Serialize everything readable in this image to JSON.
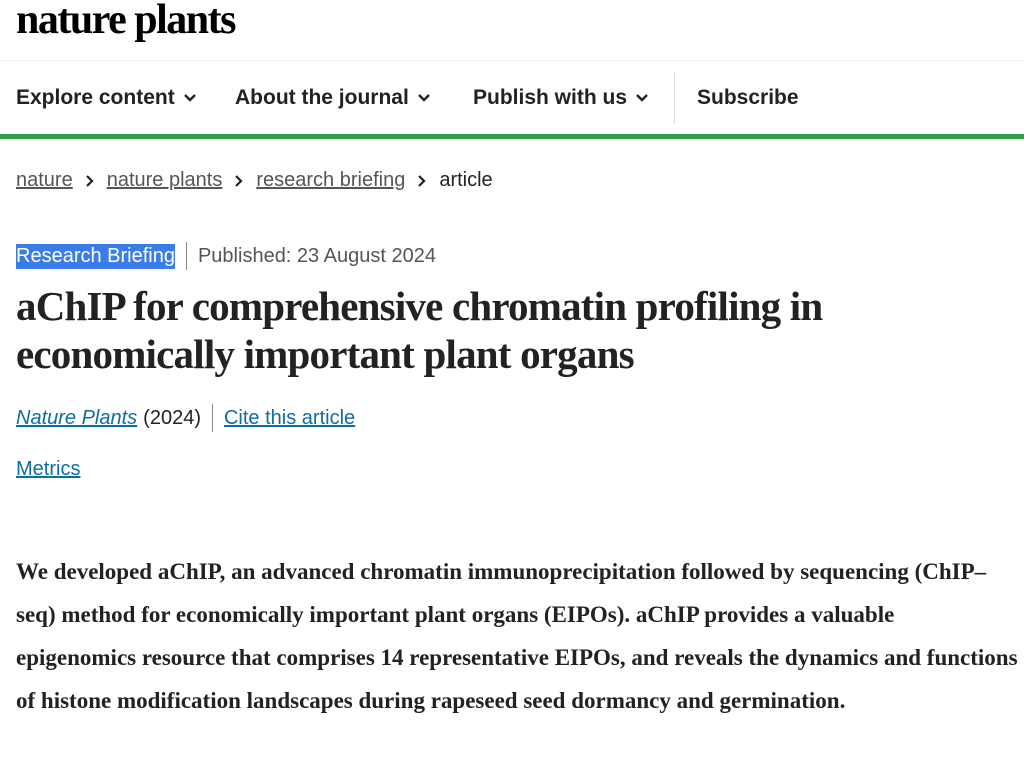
{
  "header": {
    "logo_text": "nature plants"
  },
  "nav": {
    "items": [
      {
        "label": "Explore content",
        "has_dropdown": true
      },
      {
        "label": "About the journal",
        "has_dropdown": true
      },
      {
        "label": "Publish with us",
        "has_dropdown": true
      }
    ],
    "subscribe_label": "Subscribe",
    "accent_color": "#2f9e44"
  },
  "breadcrumb": {
    "items": [
      "nature",
      "nature plants",
      "research briefing"
    ],
    "current": "article"
  },
  "article": {
    "type_label": "Research Briefing",
    "published": "Published: 23 August 2024",
    "title": "aChIP for comprehensive chromatin profiling in economically important plant organs",
    "journal": "Nature Plants",
    "year": "(2024)",
    "cite_label": "Cite this article",
    "metrics_label": "Metrics",
    "abstract": "We developed aChIP, an advanced chromatin immunoprecipitation followed by sequencing (ChIP–seq) method for economically important plant organs (EIPOs). aChIP provides a valuable epigenomics resource that comprises 14 representative EIPOs, and reveals the dynamics and functions of histone modification landscapes during rapeseed seed dormancy and germination."
  },
  "colors": {
    "link": "#0b6fa4",
    "selection": "#3b7de8",
    "text": "#222222"
  },
  "icons": {
    "dropdown": "chevron-down-icon",
    "breadcrumb_separator": "chevron-right-icon"
  }
}
